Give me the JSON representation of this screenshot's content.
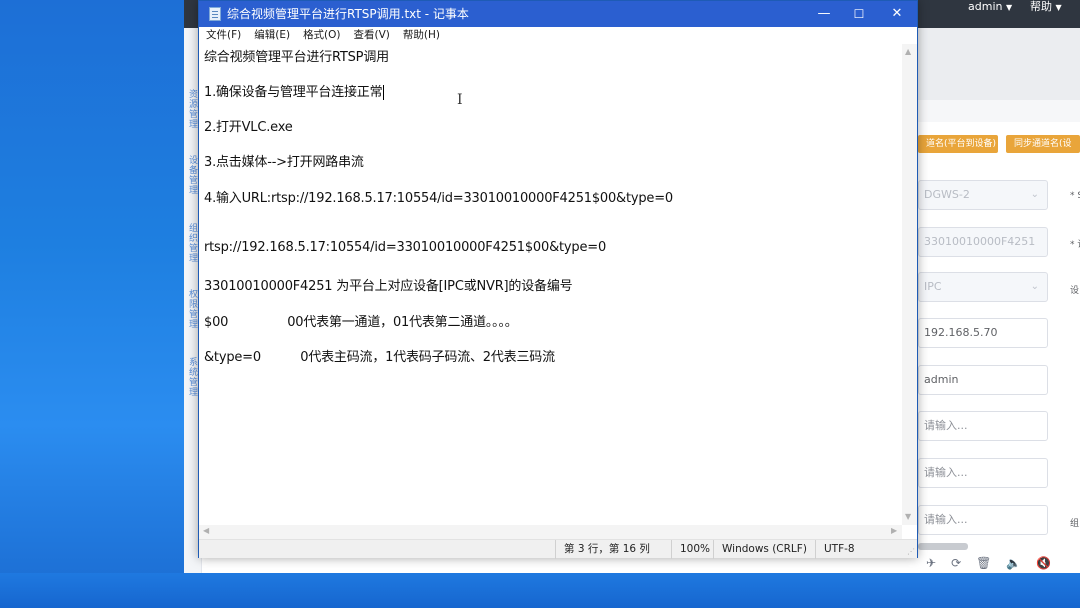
{
  "background_app": {
    "user": "admin",
    "help": "帮助",
    "buttons": [
      "道名(平台到设备)",
      "同步通道名(设"
    ],
    "fields": [
      {
        "value": "DGWS-2",
        "disabled": true,
        "dropdown": true
      },
      {
        "value": "33010010000F4251",
        "disabled": true,
        "dropdown": false
      },
      {
        "value": "IPC",
        "disabled": true,
        "dropdown": true
      },
      {
        "value": "192.168.5.70",
        "disabled": false,
        "dropdown": false
      },
      {
        "value": "admin",
        "disabled": false,
        "dropdown": false
      },
      {
        "placeholder": "请输入...",
        "disabled": false,
        "dropdown": false
      },
      {
        "placeholder": "请输入...",
        "disabled": false,
        "dropdown": false
      },
      {
        "placeholder": "请输入...",
        "disabled": false,
        "dropdown": false
      }
    ],
    "side_labels": [
      "* S",
      "* 设",
      "设",
      "组"
    ],
    "sidebar_texts": [
      "资源管理",
      "设备管理",
      "组织管理",
      "权限管理",
      "系统管理"
    ]
  },
  "notepad": {
    "title": "综合视频管理平台进行RTSP调用.txt - 记事本",
    "window_controls": {
      "minimize": "—",
      "maximize": "☐",
      "close": "✕"
    },
    "menu": [
      "文件(F)",
      "编辑(E)",
      "格式(O)",
      "查看(V)",
      "帮助(H)"
    ],
    "lines": [
      "综合视频管理平台进行RTSP调用",
      "1.确保设备与管理平台连接正常",
      "2.打开VLC.exe",
      "3.点击媒体-->打开网路串流",
      "4.输入URL:rtsp://192.168.5.17:10554/id=33010010000F4251$00&type=0",
      "rtsp://192.168.5.17:10554/id=33010010000F4251$00&type=0",
      "33010010000F4251 为平台上对应设备[IPC或NVR]的设备编号",
      "$00               00代表第一通道，01代表第二通道。。。。",
      "&type=0          0代表主码流，1代表码子码流、2代表三码流"
    ],
    "status": {
      "position": "第 3 行，第 16 列",
      "zoom": "100%",
      "line_ending": "Windows (CRLF)",
      "encoding": "UTF-8"
    }
  }
}
